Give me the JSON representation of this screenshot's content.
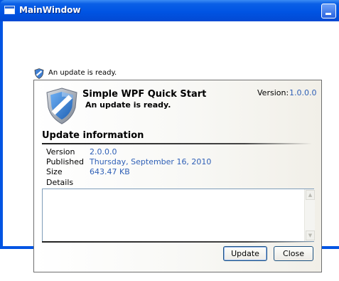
{
  "window": {
    "title": "MainWindow"
  },
  "notice": {
    "text": "An update is ready."
  },
  "popup": {
    "app_name": "Simple WPF Quick Start",
    "subtitle": "An update is ready.",
    "current_version_label": "Version:",
    "current_version": "1.0.0.0",
    "section_title": "Update information",
    "rows": [
      {
        "label": "Version",
        "value": "2.0.0.0"
      },
      {
        "label": "Published",
        "value": "Thursday, September 16, 2010"
      },
      {
        "label": "Size",
        "value": "643.47 KB"
      },
      {
        "label": "Details",
        "value": ""
      }
    ],
    "details_text": "",
    "buttons": {
      "update": "Update",
      "close": "Close"
    }
  },
  "colors": {
    "titlebar": "#0054e3",
    "link_value": "#2e5fb6",
    "shield": "#3f7fd3"
  }
}
